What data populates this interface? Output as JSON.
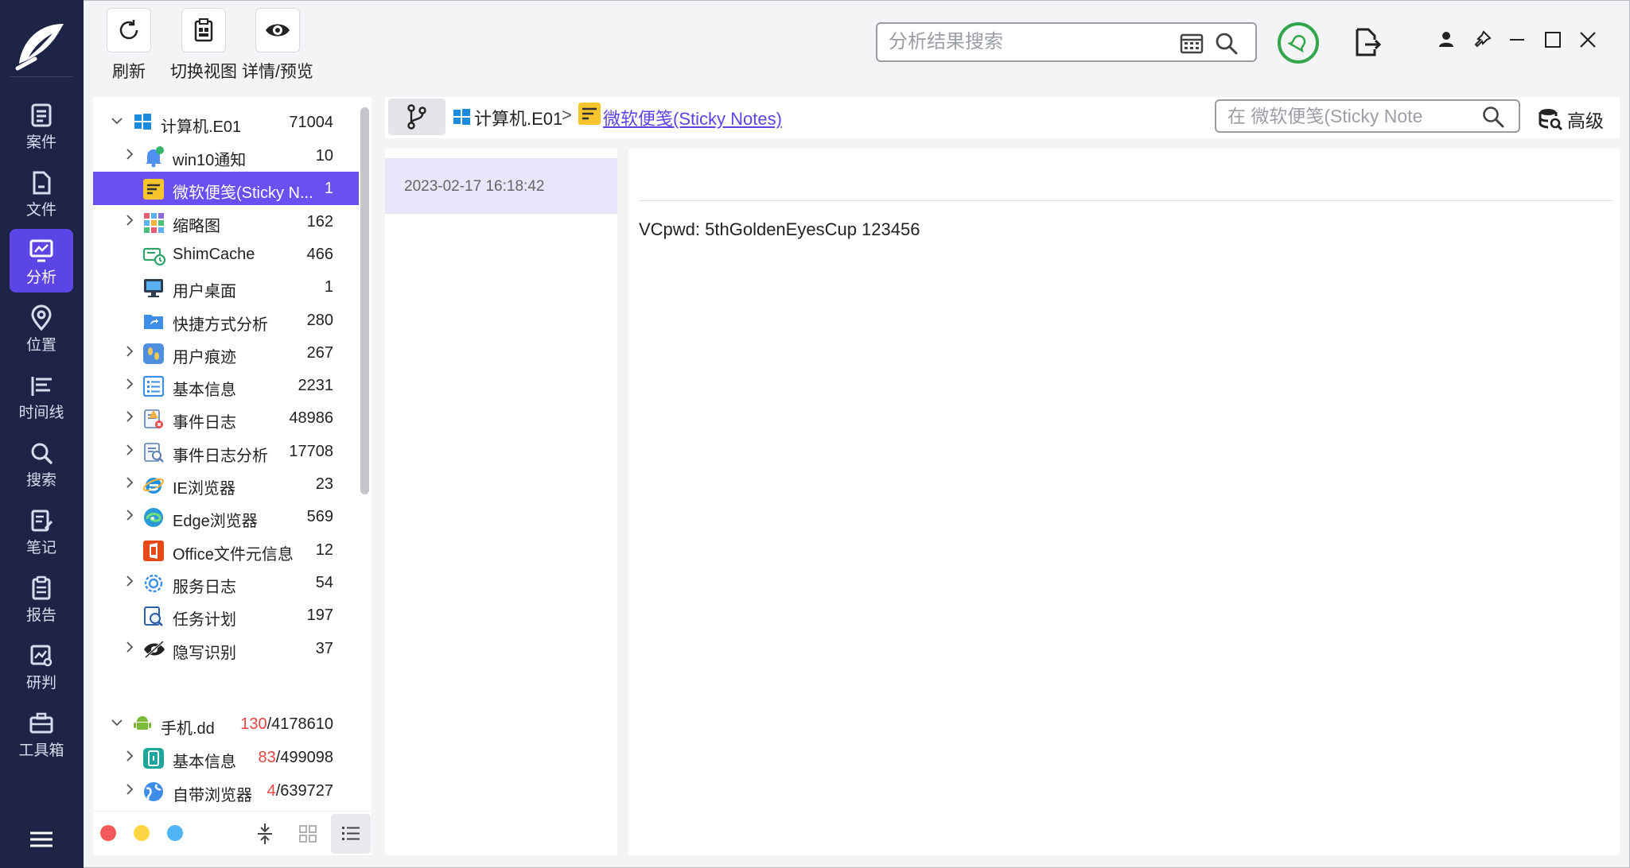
{
  "toolbar": {
    "refresh": "刷新",
    "switch_view": "切换视图",
    "details": "详情/预览"
  },
  "top_search": {
    "placeholder": "分析结果搜索"
  },
  "rail": {
    "items": [
      {
        "label": "案件"
      },
      {
        "label": "文件"
      },
      {
        "label": "分析"
      },
      {
        "label": "位置"
      },
      {
        "label": "时间线"
      },
      {
        "label": "搜索"
      },
      {
        "label": "笔记"
      },
      {
        "label": "报告"
      },
      {
        "label": "研判"
      },
      {
        "label": "工具箱"
      }
    ]
  },
  "tree": {
    "computer": {
      "name": "计算机.E01",
      "count": "71004"
    },
    "children": [
      {
        "name": "win10通知",
        "count": "10"
      },
      {
        "name": "微软便笺(Sticky N...",
        "count": "1"
      },
      {
        "name": "缩略图",
        "count": "162"
      },
      {
        "name": "ShimCache",
        "count": "466"
      },
      {
        "name": "用户桌面",
        "count": "1"
      },
      {
        "name": "快捷方式分析",
        "count": "280"
      },
      {
        "name": "用户痕迹",
        "count": "267"
      },
      {
        "name": "基本信息",
        "count": "2231"
      },
      {
        "name": "事件日志",
        "count": "48986"
      },
      {
        "name": "事件日志分析",
        "count": "17708"
      },
      {
        "name": "IE浏览器",
        "count": "23"
      },
      {
        "name": "Edge浏览器",
        "count": "569"
      },
      {
        "name": "Office文件元信息",
        "count": "12"
      },
      {
        "name": "服务日志",
        "count": "54"
      },
      {
        "name": "任务计划",
        "count": "197"
      },
      {
        "name": "隐写识别",
        "count": "37"
      }
    ],
    "phone": {
      "name": "手机.dd",
      "count_red": "130",
      "count_total": "/4178610"
    },
    "phone_children": [
      {
        "name": "基本信息",
        "count_red": "83",
        "count_total": "/499098"
      },
      {
        "name": "自带浏览器",
        "count_red": "4",
        "count_total": "/639727"
      }
    ]
  },
  "breadcrumb": {
    "root": "计算机.E01",
    "sep": ">",
    "current": "微软便笺(Sticky Notes)"
  },
  "sub_search": {
    "placeholder": "在 微软便笺(Sticky Note"
  },
  "advanced": "高级",
  "records": [
    {
      "time": "2023-02-17 16:18:42"
    }
  ],
  "detail": {
    "text": "VCpwd: 5thGoldenEyesCup 123456"
  },
  "colors": {
    "accent": "#5b45e4",
    "rail": "#1d2446",
    "dot_red": "#f05a5a",
    "dot_yellow": "#fdd643",
    "dot_blue": "#4fb3f5"
  }
}
